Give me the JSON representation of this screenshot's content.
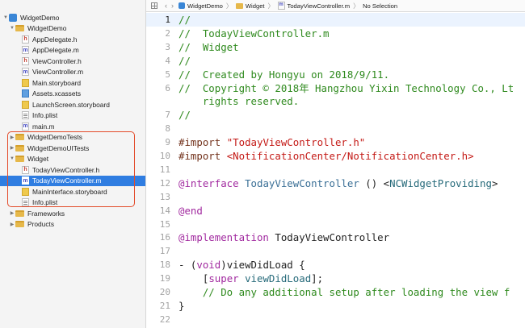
{
  "navigator": {
    "items": [
      {
        "label": "WidgetDemo",
        "icon": "project-icon",
        "kind": "project",
        "level": 0,
        "disclosure": "▼",
        "selected": false
      },
      {
        "label": "WidgetDemo",
        "icon": "folder-icon",
        "kind": "folder",
        "level": 1,
        "disclosure": "▼",
        "selected": false
      },
      {
        "label": "AppDelegate.h",
        "icon": "h-file-icon",
        "kind": "h-file",
        "glyph": "h",
        "level": 2,
        "disclosure": "",
        "selected": false
      },
      {
        "label": "AppDelegate.m",
        "icon": "m-file-icon",
        "kind": "m-file",
        "glyph": "m",
        "level": 2,
        "disclosure": "",
        "selected": false
      },
      {
        "label": "ViewController.h",
        "icon": "h-file-icon",
        "kind": "h-file",
        "glyph": "h",
        "level": 2,
        "disclosure": "",
        "selected": false
      },
      {
        "label": "ViewController.m",
        "icon": "m-file-icon",
        "kind": "m-file",
        "glyph": "m",
        "level": 2,
        "disclosure": "",
        "selected": false
      },
      {
        "label": "Main.storyboard",
        "icon": "storyboard-icon",
        "kind": "storyboard",
        "level": 2,
        "disclosure": "",
        "selected": false
      },
      {
        "label": "Assets.xcassets",
        "icon": "assets-icon",
        "kind": "assets",
        "level": 2,
        "disclosure": "",
        "selected": false
      },
      {
        "label": "LaunchScreen.storyboard",
        "icon": "storyboard-icon",
        "kind": "storyboard",
        "level": 2,
        "disclosure": "",
        "selected": false
      },
      {
        "label": "Info.plist",
        "icon": "plist-icon",
        "kind": "plist",
        "level": 2,
        "disclosure": "",
        "selected": false
      },
      {
        "label": "main.m",
        "icon": "m-file-icon",
        "kind": "m-file",
        "glyph": "m",
        "level": 2,
        "disclosure": "",
        "selected": false
      },
      {
        "label": "WidgetDemoTests",
        "icon": "folder-icon",
        "kind": "folder",
        "level": 1,
        "disclosure": "▶",
        "selected": false
      },
      {
        "label": "WidgetDemoUITests",
        "icon": "folder-icon",
        "kind": "folder",
        "level": 1,
        "disclosure": "▶",
        "selected": false
      },
      {
        "label": "Widget",
        "icon": "folder-icon",
        "kind": "folder",
        "level": 1,
        "disclosure": "▼",
        "selected": false
      },
      {
        "label": "TodayViewController.h",
        "icon": "h-file-icon",
        "kind": "h-file",
        "glyph": "h",
        "level": 2,
        "disclosure": "",
        "selected": false
      },
      {
        "label": "TodayViewController.m",
        "icon": "m-file-icon",
        "kind": "m-file",
        "glyph": "m",
        "level": 2,
        "disclosure": "",
        "selected": true
      },
      {
        "label": "MainInterface.storyboard",
        "icon": "storyboard-icon",
        "kind": "storyboard",
        "level": 2,
        "disclosure": "",
        "selected": false
      },
      {
        "label": "Info.plist",
        "icon": "plist-icon",
        "kind": "plist",
        "level": 2,
        "disclosure": "",
        "selected": false
      },
      {
        "label": "Frameworks",
        "icon": "folder-icon",
        "kind": "folder",
        "level": 1,
        "disclosure": "▶",
        "selected": false
      },
      {
        "label": "Products",
        "icon": "folder-icon",
        "kind": "folder",
        "level": 1,
        "disclosure": "▶",
        "selected": false
      }
    ],
    "highlight_color": "#e34b2a",
    "selection_color": "#2f7de1"
  },
  "jumpbar": {
    "back": "‹",
    "forward": "›",
    "crumbs": [
      "WidgetDemo",
      "Widget",
      "TodayViewController.m",
      "No Selection"
    ],
    "separator": "〉"
  },
  "editor": {
    "current_line": 1,
    "lines": [
      {
        "n": "1",
        "tokens": [
          {
            "t": "//",
            "c": "comment"
          }
        ]
      },
      {
        "n": "2",
        "tokens": [
          {
            "t": "//  TodayViewController.m",
            "c": "comment"
          }
        ]
      },
      {
        "n": "3",
        "tokens": [
          {
            "t": "//  Widget",
            "c": "comment"
          }
        ]
      },
      {
        "n": "4",
        "tokens": [
          {
            "t": "//",
            "c": "comment"
          }
        ]
      },
      {
        "n": "5",
        "tokens": [
          {
            "t": "//  Created by Hongyu on 2018/9/11.",
            "c": "comment"
          }
        ]
      },
      {
        "n": "6",
        "tokens": [
          {
            "t": "//  Copyright © 2018年 Hangzhou Yixin Technology Co., Lt",
            "c": "comment"
          }
        ]
      },
      {
        "n": "",
        "tokens": [
          {
            "t": "    rights reserved.",
            "c": "comment"
          }
        ]
      },
      {
        "n": "7",
        "tokens": [
          {
            "t": "//",
            "c": "comment"
          }
        ]
      },
      {
        "n": "8",
        "tokens": []
      },
      {
        "n": "9",
        "tokens": [
          {
            "t": "#import ",
            "c": "pre"
          },
          {
            "t": "\"TodayViewController.h\"",
            "c": "str"
          }
        ]
      },
      {
        "n": "10",
        "tokens": [
          {
            "t": "#import ",
            "c": "pre"
          },
          {
            "t": "<NotificationCenter/NotificationCenter.h>",
            "c": "str"
          }
        ]
      },
      {
        "n": "11",
        "tokens": []
      },
      {
        "n": "12",
        "tokens": [
          {
            "t": "@interface ",
            "c": "kw"
          },
          {
            "t": "TodayViewController",
            "c": "type"
          },
          {
            "t": " () <",
            "c": "plain"
          },
          {
            "t": "NCWidgetProviding",
            "c": "func"
          },
          {
            "t": ">",
            "c": "plain"
          }
        ]
      },
      {
        "n": "13",
        "tokens": []
      },
      {
        "n": "14",
        "tokens": [
          {
            "t": "@end",
            "c": "kw"
          }
        ]
      },
      {
        "n": "15",
        "tokens": []
      },
      {
        "n": "16",
        "tokens": [
          {
            "t": "@implementation ",
            "c": "kw"
          },
          {
            "t": "TodayViewController",
            "c": "plain"
          }
        ]
      },
      {
        "n": "17",
        "tokens": []
      },
      {
        "n": "18",
        "tokens": [
          {
            "t": "- (",
            "c": "plain"
          },
          {
            "t": "void",
            "c": "kw"
          },
          {
            "t": ")viewDidLoad {",
            "c": "plain"
          }
        ]
      },
      {
        "n": "19",
        "tokens": [
          {
            "t": "    [",
            "c": "plain"
          },
          {
            "t": "super",
            "c": "kw"
          },
          {
            "t": " ",
            "c": "plain"
          },
          {
            "t": "viewDidLoad",
            "c": "func"
          },
          {
            "t": "];",
            "c": "plain"
          }
        ]
      },
      {
        "n": "20",
        "tokens": [
          {
            "t": "    // Do any additional setup after loading the view f",
            "c": "comment"
          }
        ]
      },
      {
        "n": "21",
        "tokens": [
          {
            "t": "}",
            "c": "plain"
          }
        ]
      },
      {
        "n": "22",
        "tokens": []
      }
    ]
  }
}
